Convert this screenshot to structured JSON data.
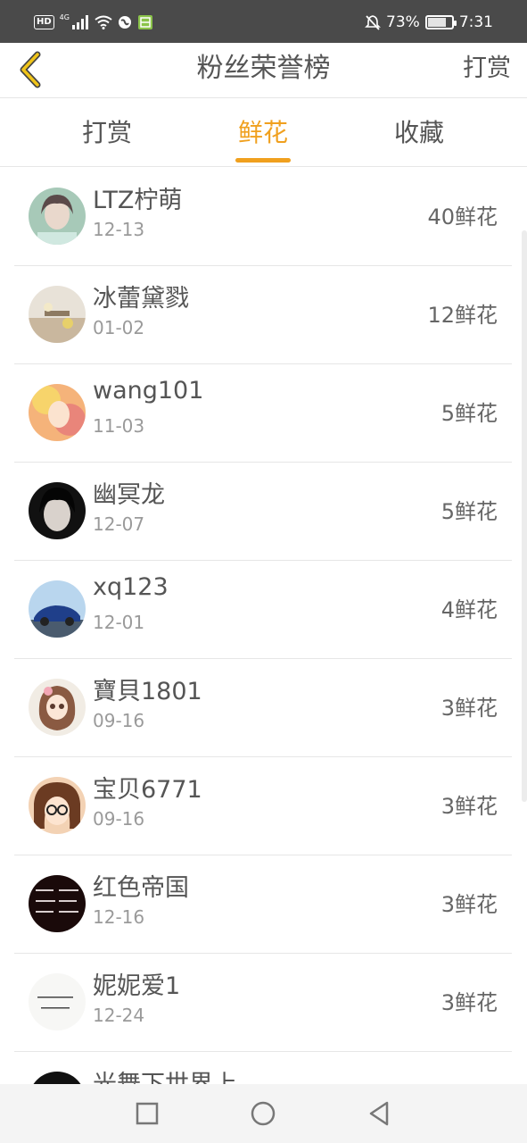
{
  "status_bar": {
    "hd_label": "HD",
    "network_label": "4G",
    "battery_percent": "73%",
    "battery_level": 0.73,
    "time": "7:31",
    "icons": [
      "signal-icon",
      "wifi-icon",
      "globe-icon",
      "app-notification-icon",
      "mute-icon",
      "battery-icon"
    ]
  },
  "header": {
    "title": "粉丝荣誉榜",
    "action": "打赏",
    "back_icon": "chevron-left-icon",
    "accent_color": "#f0c419"
  },
  "tabs": [
    {
      "label": "打赏",
      "active": false
    },
    {
      "label": "鲜花",
      "active": true
    },
    {
      "label": "收藏",
      "active": false
    }
  ],
  "accent_color": "#f0a01e",
  "fans": [
    {
      "name": "LTZ柠萌",
      "date": "12-13",
      "count": "40鲜花"
    },
    {
      "name": "冰蕾黛戮",
      "date": "01-02",
      "count": "12鲜花"
    },
    {
      "name": "wang101",
      "date": "11-03",
      "count": "5鲜花"
    },
    {
      "name": "幽冥龙",
      "date": "12-07",
      "count": "5鲜花"
    },
    {
      "name": "xq123",
      "date": "12-01",
      "count": "4鲜花"
    },
    {
      "name": "寶貝1801",
      "date": "09-16",
      "count": "3鲜花"
    },
    {
      "name": "宝贝6771",
      "date": "09-16",
      "count": "3鲜花"
    },
    {
      "name": "红色帝国",
      "date": "12-16",
      "count": "3鲜花"
    },
    {
      "name": "妮妮爱1",
      "date": "12-24",
      "count": "3鲜花"
    },
    {
      "name": "光舞下世界上",
      "date": "",
      "count": ""
    }
  ],
  "nav_bar": {
    "icons": [
      "recent-apps-icon",
      "home-icon",
      "back-triangle-icon"
    ]
  }
}
